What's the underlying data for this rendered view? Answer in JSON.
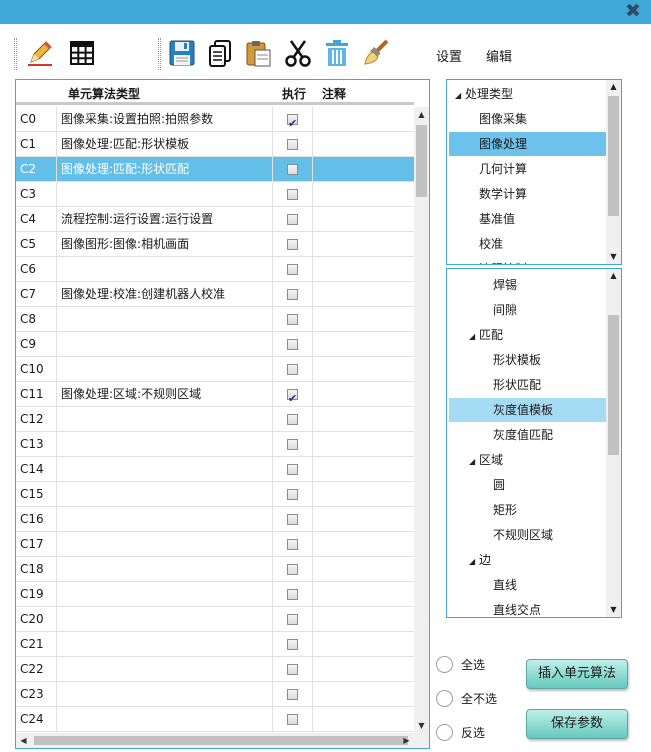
{
  "titlebar": {
    "close_icon": "close-icon",
    "accent_color": "#3fa8d8"
  },
  "toolbar": {
    "icons": [
      "pencil-icon",
      "table-grid-icon",
      "save-disk-icon",
      "copy-document-icon",
      "paste-clipboard-icon",
      "scissors-cut-icon",
      "trash-can-icon",
      "brush-clear-icon"
    ],
    "menu": {
      "settings": "设置",
      "edit": "编辑"
    }
  },
  "grid": {
    "headers": {
      "type": "单元算法类型",
      "exec": "执行",
      "note": "注释"
    },
    "selected_color": "#64bfe8",
    "rows": [
      {
        "id": "C0",
        "type": "图像采集:设置拍照:拍照参数",
        "exec": true,
        "note": ""
      },
      {
        "id": "C1",
        "type": "图像处理:匹配:形状模板",
        "exec": false,
        "note": ""
      },
      {
        "id": "C2",
        "type": "图像处理:匹配:形状匹配",
        "exec": false,
        "note": "",
        "selected": true
      },
      {
        "id": "C3",
        "type": "",
        "exec": false,
        "note": ""
      },
      {
        "id": "C4",
        "type": "流程控制:运行设置:运行设置",
        "exec": false,
        "note": ""
      },
      {
        "id": "C5",
        "type": "图像图形:图像:相机画面",
        "exec": false,
        "note": ""
      },
      {
        "id": "C6",
        "type": "",
        "exec": false,
        "note": ""
      },
      {
        "id": "C7",
        "type": "图像处理:校准:创建机器人校准",
        "exec": false,
        "note": ""
      },
      {
        "id": "C8",
        "type": "",
        "exec": false,
        "note": ""
      },
      {
        "id": "C9",
        "type": "",
        "exec": false,
        "note": ""
      },
      {
        "id": "C10",
        "type": "",
        "exec": false,
        "note": ""
      },
      {
        "id": "C11",
        "type": "图像处理:区域:不规则区域",
        "exec": true,
        "note": ""
      },
      {
        "id": "C12",
        "type": "",
        "exec": false,
        "note": ""
      },
      {
        "id": "C13",
        "type": "",
        "exec": false,
        "note": ""
      },
      {
        "id": "C14",
        "type": "",
        "exec": false,
        "note": ""
      },
      {
        "id": "C15",
        "type": "",
        "exec": false,
        "note": ""
      },
      {
        "id": "C16",
        "type": "",
        "exec": false,
        "note": ""
      },
      {
        "id": "C17",
        "type": "",
        "exec": false,
        "note": ""
      },
      {
        "id": "C18",
        "type": "",
        "exec": false,
        "note": ""
      },
      {
        "id": "C19",
        "type": "",
        "exec": false,
        "note": ""
      },
      {
        "id": "C20",
        "type": "",
        "exec": false,
        "note": ""
      },
      {
        "id": "C21",
        "type": "",
        "exec": false,
        "note": ""
      },
      {
        "id": "C22",
        "type": "",
        "exec": false,
        "note": ""
      },
      {
        "id": "C23",
        "type": "",
        "exec": false,
        "note": ""
      },
      {
        "id": "C24",
        "type": "",
        "exec": false,
        "note": ""
      }
    ]
  },
  "tree_top": {
    "nodes": [
      {
        "label": "处理类型",
        "level": 0,
        "expanded": true
      },
      {
        "label": "图像采集",
        "level": 1
      },
      {
        "label": "图像处理",
        "level": 1,
        "selected": true
      },
      {
        "label": "几何计算",
        "level": 1
      },
      {
        "label": "数学计算",
        "level": 1
      },
      {
        "label": "基准值",
        "level": 1
      },
      {
        "label": "校准",
        "level": 1
      },
      {
        "label": "流程控制",
        "level": 1
      }
    ]
  },
  "tree_bottom": {
    "nodes": [
      {
        "label": "焊锡",
        "level": 2
      },
      {
        "label": "间隙",
        "level": 2
      },
      {
        "label": "匹配",
        "level": 1,
        "expanded": true
      },
      {
        "label": "形状模板",
        "level": 2
      },
      {
        "label": "形状匹配",
        "level": 2
      },
      {
        "label": "灰度值模板",
        "level": 2,
        "highlight": true
      },
      {
        "label": "灰度值匹配",
        "level": 2
      },
      {
        "label": "区域",
        "level": 1,
        "expanded": true
      },
      {
        "label": "圆",
        "level": 2
      },
      {
        "label": "矩形",
        "level": 2
      },
      {
        "label": "不规则区域",
        "level": 2
      },
      {
        "label": "边",
        "level": 1,
        "expanded": true
      },
      {
        "label": "直线",
        "level": 2
      },
      {
        "label": "直线交点",
        "level": 2
      }
    ]
  },
  "options": {
    "select_all": "全选",
    "select_none": "全不选",
    "invert": "反选"
  },
  "buttons": {
    "insert": "插入单元算法",
    "save": "保存参数"
  }
}
